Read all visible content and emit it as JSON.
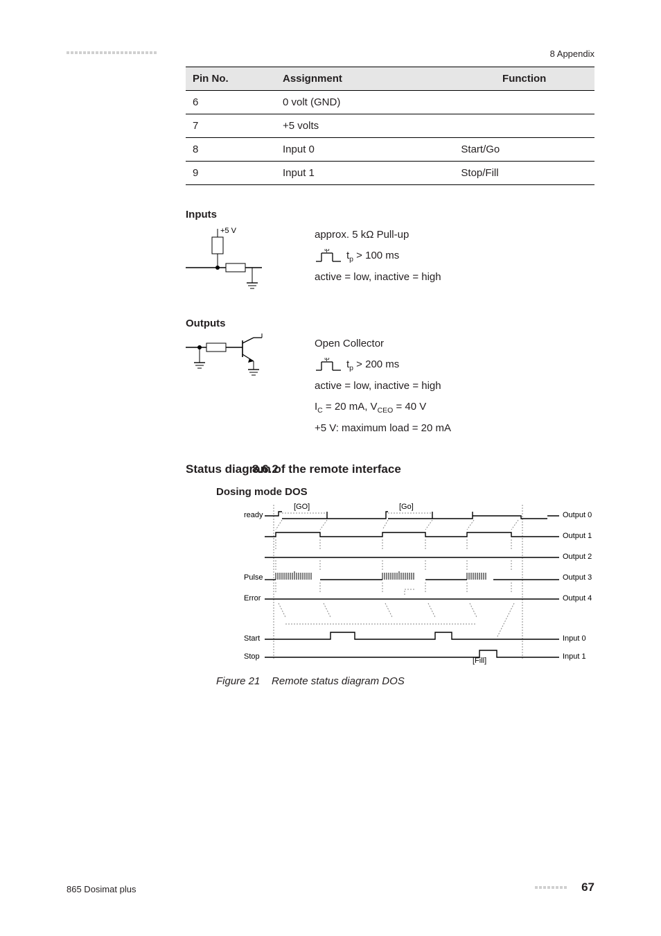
{
  "header": {
    "right": "8 Appendix"
  },
  "table": {
    "headers": [
      "Pin No.",
      "Assignment",
      "Function"
    ],
    "rows": [
      {
        "pin": "6",
        "assign": "0 volt (GND)",
        "func": ""
      },
      {
        "pin": "7",
        "assign": "+5 volts",
        "func": ""
      },
      {
        "pin": "8",
        "assign": "Input 0",
        "func": "Start/Go"
      },
      {
        "pin": "9",
        "assign": "Input 1",
        "func": "Stop/Fill"
      }
    ]
  },
  "inputs": {
    "title": "Inputs",
    "five_v": "+5 V",
    "pullup": "approx. 5 kΩ Pull-up",
    "tp_label": "tp",
    "tp_suffix": " > 100 ms",
    "active": "active = low, inactive = high"
  },
  "outputs": {
    "title": "Outputs",
    "oc": "Open Collector",
    "tp_label": "tp",
    "tp_suffix": " > 200 ms",
    "active": "active = low, inactive = high",
    "ic_line_a": "I",
    "ic_line_b": " = 20 mA, V",
    "ic_line_c": " = 40 V",
    "sub_c": "C",
    "sub_ceo": "CEO",
    "maxload": "+5 V: maximum load = 20 mA"
  },
  "section": {
    "num": "8.6.2",
    "title": "Status diagram of the remote interface"
  },
  "mode": {
    "title": "Dosing mode DOS"
  },
  "fig": {
    "num": "Figure 21",
    "cap": "Remote status diagram DOS"
  },
  "diagram": {
    "left_labels": [
      "ready",
      "Pulse",
      "Error",
      "Start",
      "Stop"
    ],
    "right_labels": [
      "Output 0",
      "Output 1",
      "Output 2",
      "Output 3",
      "Output 4",
      "Input 0",
      "Input 1"
    ],
    "go1": "[GO]",
    "go2": "[Go]",
    "fill": "[Fill]"
  },
  "footer": {
    "left": "865 Dosimat plus",
    "page": "67"
  }
}
